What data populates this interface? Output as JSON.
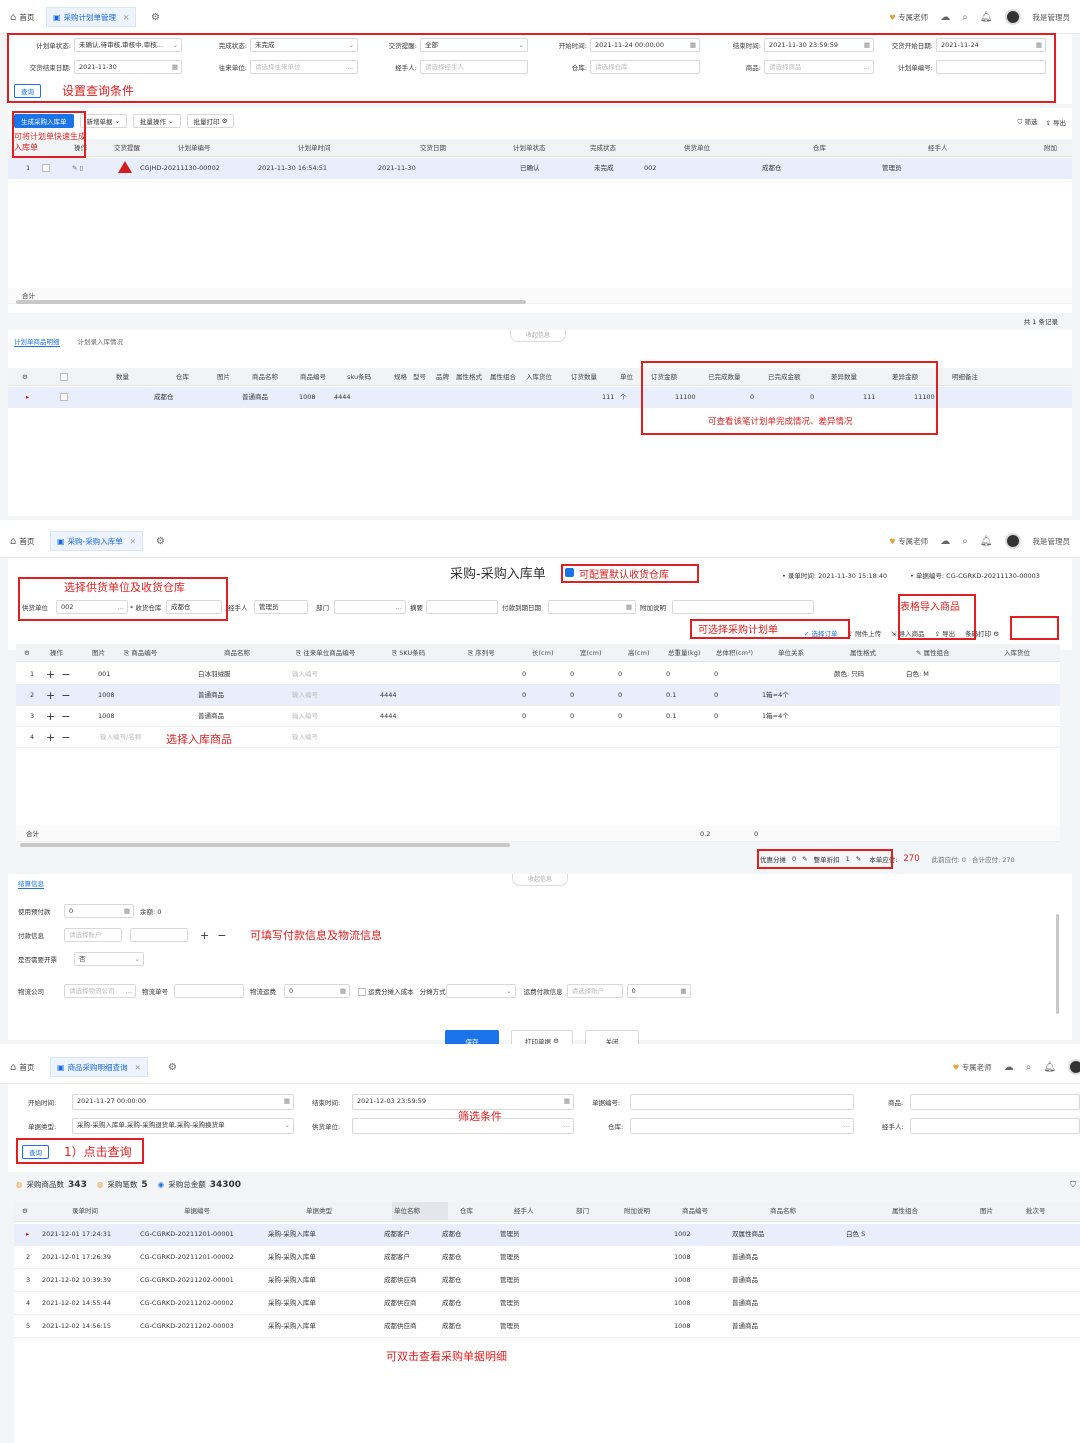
{
  "p1": {
    "tabs": [
      "首页",
      "采购计划单管理"
    ],
    "teacher": "专属老师",
    "admin": "我是管理员",
    "filters": [
      {
        "label": "计划单状态:",
        "value": "未确认,待审核,审核中,审核..."
      },
      {
        "label": "完成状态:",
        "value": "未完成"
      },
      {
        "label": "交货提醒:",
        "value": "全部"
      },
      {
        "label": "开始时间:",
        "value": "2021-11-24 00:00:00"
      },
      {
        "label": "结束时间:",
        "value": "2021-11-30 23:59:59"
      },
      {
        "label": "交货开始日期:",
        "value": "2021-11-24"
      },
      {
        "label": "交货结束日期:",
        "value": "2021-11-30"
      },
      {
        "label": "往来单位:",
        "placeholder": "请选择往来单位"
      },
      {
        "label": "经手人:",
        "placeholder": "请选择经手人"
      },
      {
        "label": "仓库:",
        "placeholder": "请选择仓库"
      },
      {
        "label": "商品:",
        "placeholder": "请选择商品"
      },
      {
        "label": "计划单编号:",
        "placeholder": ""
      }
    ],
    "query_btn": "查询",
    "anno_query": "设置查询条件",
    "toolbar": [
      "生成采购入库单",
      "新增单据",
      "批量操作",
      "批量打印"
    ],
    "filter_label": "筛选",
    "export_label": "导出",
    "anno_gen": "可将计划单快速生成入库单",
    "headers": [
      "操作",
      "交货提醒",
      "计划单编号",
      "计划单时间",
      "交货日期",
      "计划单状态",
      "完成状态",
      "供货单位",
      "仓库",
      "经手人",
      "附加"
    ],
    "row": {
      "no": "1",
      "code": "CGJHD-20211130-00002",
      "time": "2021-11-30 16:54:51",
      "date": "2021-11-30",
      "state": "已确认",
      "done": "未完成",
      "supplier": "002",
      "wh": "成都仓",
      "handler": "管理员"
    },
    "total_label": "合计",
    "records": "共 1 条记录",
    "subtabs": [
      "计划单商品明细",
      "计划录入库情况"
    ],
    "collapse": "收起信息",
    "detail_headers": [
      "数量",
      "仓库",
      "图片",
      "商品名称",
      "商品编号",
      "sku条码",
      "规格",
      "型号",
      "品牌",
      "属性格式",
      "属性组合",
      "入库货位",
      "订货数量",
      "单位",
      "订货金额",
      "已完成数量",
      "已完成金额",
      "差异数量",
      "差异金额",
      "明细备注"
    ],
    "detail_row": {
      "wh": "成都仓",
      "name": "普通商品",
      "code": "1008",
      "sku": "4444",
      "qty": "111",
      "unit": "个",
      "amount": "11100",
      "done_qty": "0",
      "done_amt": "0",
      "diff_qty": "111",
      "diff_amt": "11100"
    },
    "anno_diff": "可查看该笔计划单完成情况、差异情况"
  },
  "p2": {
    "tabs": [
      "首页",
      "采购-采购入库单"
    ],
    "teacher": "专属老师",
    "admin": "我是管理员",
    "title": "采购-采购入库单",
    "anno_default_wh": "可配置默认收货仓库",
    "record_time": "• 录单时间: 2021-11-30 15:18:40",
    "doc_no": "• 单据编号: CG-CGRKD-20211130-00003",
    "anno_supplier": "选择供货单位及收货仓库",
    "fields": [
      {
        "label": "供货单位",
        "value": "002"
      },
      {
        "label": "* 收货仓库",
        "value": "成都仓"
      },
      {
        "label": "经手人",
        "value": "管理员"
      },
      {
        "label": "部门",
        "value": ""
      },
      {
        "label": "摘要",
        "value": ""
      },
      {
        "label": "付款到期日期",
        "value": ""
      },
      {
        "label": "附加说明",
        "value": ""
      }
    ],
    "anno_import": "表格导入商品",
    "anno_plan": "可选择采购计划单",
    "tools": [
      "选择订单",
      "附件上传",
      "导入商品",
      "导出",
      "条码打印"
    ],
    "headers": [
      "操作",
      "图片",
      "商品编号",
      "商品名称",
      "往来单位商品编号",
      "SKU条码",
      "序列号",
      "长(cm)",
      "宽(cm)",
      "高(cm)",
      "总重量(kg)",
      "总体积(cm³)",
      "单位关系",
      "属性格式",
      "属性组合",
      "入库货位"
    ],
    "rows": [
      {
        "no": "1",
        "code": "001",
        "name": "白冰羽绒服",
        "ph": "输入编号",
        "sku": "",
        "l": "0",
        "w": "0",
        "h": "0",
        "wt": "0",
        "vol": "0",
        "rel": "",
        "fmt": "颜色: 只码",
        "comb": "白色: M"
      },
      {
        "no": "2",
        "code": "1008",
        "name": "普通商品",
        "ph": "输入编号",
        "sku": "4444",
        "l": "0",
        "w": "0",
        "h": "0",
        "wt": "0.1",
        "vol": "0",
        "rel": "1箱=4个",
        "fmt": "",
        "comb": ""
      },
      {
        "no": "3",
        "code": "1008",
        "name": "普通商品",
        "ph": "输入编号",
        "sku": "4444",
        "l": "0",
        "w": "0",
        "h": "0",
        "wt": "0.1",
        "vol": "0",
        "rel": "1箱=4个",
        "fmt": "",
        "comb": ""
      },
      {
        "no": "4",
        "code": "输入编号/名称",
        "name": "",
        "ph": "输入编号",
        "sku": "",
        "l": "",
        "w": "",
        "h": "",
        "wt": "",
        "vol": "",
        "rel": "",
        "fmt": "",
        "comb": ""
      }
    ],
    "anno_goods": "选择入库商品",
    "total_label": "合计",
    "total_wt": "0.2",
    "total_vol": "0",
    "summary": {
      "discount_label": "优惠分摊",
      "discount": "0",
      "whole_label": "整单折扣",
      "whole": "1",
      "due_label": "本单应付:",
      "due": "270",
      "paid_label": "此前应付: 0",
      "total_label": "合计应付: 270"
    },
    "settle_tab": "结算信息",
    "collapse": "收起信息",
    "pay_fields": [
      {
        "label": "使用预付款",
        "value": "0"
      },
      {
        "label": "余额: 0",
        "value": ""
      },
      {
        "label": "付款信息",
        "placeholder": "请选择账户"
      },
      {
        "label": "是否需要开票",
        "value": "否"
      },
      {
        "label": "物流公司",
        "placeholder": "请选择物流公司"
      },
      {
        "label": "物流单号",
        "value": ""
      },
      {
        "label": "物流运费",
        "value": "0"
      },
      {
        "label": "运费分摊入成本",
        "value": ""
      },
      {
        "label": "分摊方式",
        "value": ""
      },
      {
        "label": "运费付款信息",
        "placeholder": "请选择账户"
      }
    ],
    "anno_pay": "可填写付款信息及物流信息",
    "buttons": [
      "保存",
      "打印单据",
      "关闭"
    ]
  },
  "p3": {
    "tabs": [
      "首页",
      "商品采购明细查询"
    ],
    "teacher": "专属老师",
    "fields": [
      {
        "label": "开始时间:",
        "value": "2021-11-27 00:00:00"
      },
      {
        "label": "结束时间:",
        "value": "2021-12-03 23:59:59"
      },
      {
        "label": "单据编号:",
        "value": ""
      },
      {
        "label": "商品:",
        "value": ""
      },
      {
        "label": "单据类型:",
        "value": "采购-采购入库单,采购-采购退货单,采购-采购换货单"
      },
      {
        "label": "供货单位:",
        "value": ""
      },
      {
        "label": "仓库:",
        "value": ""
      },
      {
        "label": "经手人:",
        "value": ""
      }
    ],
    "anno_filter": "筛选条件",
    "query_btn": "查询",
    "anno_query": "1）点击查询",
    "stats": [
      {
        "label": "采购商品数",
        "value": "343"
      },
      {
        "label": "采购笔数",
        "value": "5"
      },
      {
        "label": "采购总金额",
        "value": "34300"
      }
    ],
    "headers": [
      "录单时间",
      "单据编号",
      "单据类型",
      "单位名称",
      "仓库",
      "经手人",
      "部门",
      "附加说明",
      "商品编号",
      "商品名称",
      "属性组合",
      "图片",
      "批次号"
    ],
    "rows": [
      {
        "no": "1",
        "time": "2021-12-01 17:24:31",
        "code": "CG-CGRKD-20211201-00001",
        "type": "采购-采购入库单",
        "unit": "成都客户",
        "wh": "成都仓",
        "handler": "管理员",
        "gcode": "1002",
        "gname": "双属性商品",
        "comb": "白色 S"
      },
      {
        "no": "2",
        "time": "2021-12-01 17:26:39",
        "code": "CG-CGRKD-20211201-00002",
        "type": "采购-采购入库单",
        "unit": "成都客户",
        "wh": "成都仓",
        "handler": "管理员",
        "gcode": "1008",
        "gname": "普通商品",
        "comb": ""
      },
      {
        "no": "3",
        "time": "2021-12-02 10:39:39",
        "code": "CG-CGRKD-20211202-00001",
        "type": "采购-采购入库单",
        "unit": "成都供应商",
        "wh": "成都仓",
        "handler": "管理员",
        "gcode": "1008",
        "gname": "普通商品",
        "comb": ""
      },
      {
        "no": "4",
        "time": "2021-12-02 14:55:44",
        "code": "CG-CGRKD-20211202-00002",
        "type": "采购-采购入库单",
        "unit": "成都供应商",
        "wh": "成都仓",
        "handler": "管理员",
        "gcode": "1008",
        "gname": "普通商品",
        "comb": ""
      },
      {
        "no": "5",
        "time": "2021-12-02 14:56:15",
        "code": "CG-CGRKD-20211202-00003",
        "type": "采购-采购入库单",
        "unit": "成都供应商",
        "wh": "成都仓",
        "handler": "管理员",
        "gcode": "1008",
        "gname": "普通商品",
        "comb": ""
      }
    ],
    "anno_dbl": "可双击查看采购单据明细"
  }
}
